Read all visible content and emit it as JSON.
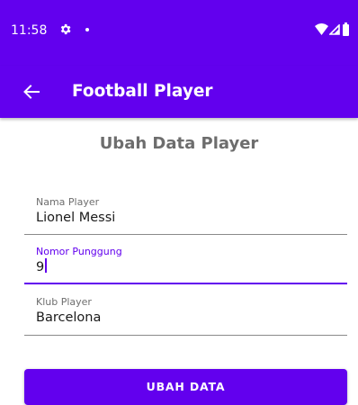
{
  "status_bar": {
    "time": "11:58",
    "icons": [
      "gear-icon",
      "notification-dot-icon",
      "wifi-icon",
      "signal-icon",
      "battery-icon"
    ]
  },
  "app_bar": {
    "title": "Football Player",
    "back_icon": "arrow-back-icon"
  },
  "form": {
    "title": "Ubah Data Player",
    "fields": [
      {
        "label": "Nama Player",
        "value": "Lionel Messi",
        "focused": false
      },
      {
        "label": "Nomor Punggung",
        "value": "9",
        "focused": true
      },
      {
        "label": "Klub Player",
        "value": "Barcelona",
        "focused": false
      }
    ],
    "submit_label": "UBAH DATA"
  },
  "colors": {
    "primary": "#6200EE",
    "title_gray": "#6d6d6d",
    "label_gray": "#6e6e6e",
    "text_dark": "#1a1a1a",
    "background": "#ffffff"
  }
}
